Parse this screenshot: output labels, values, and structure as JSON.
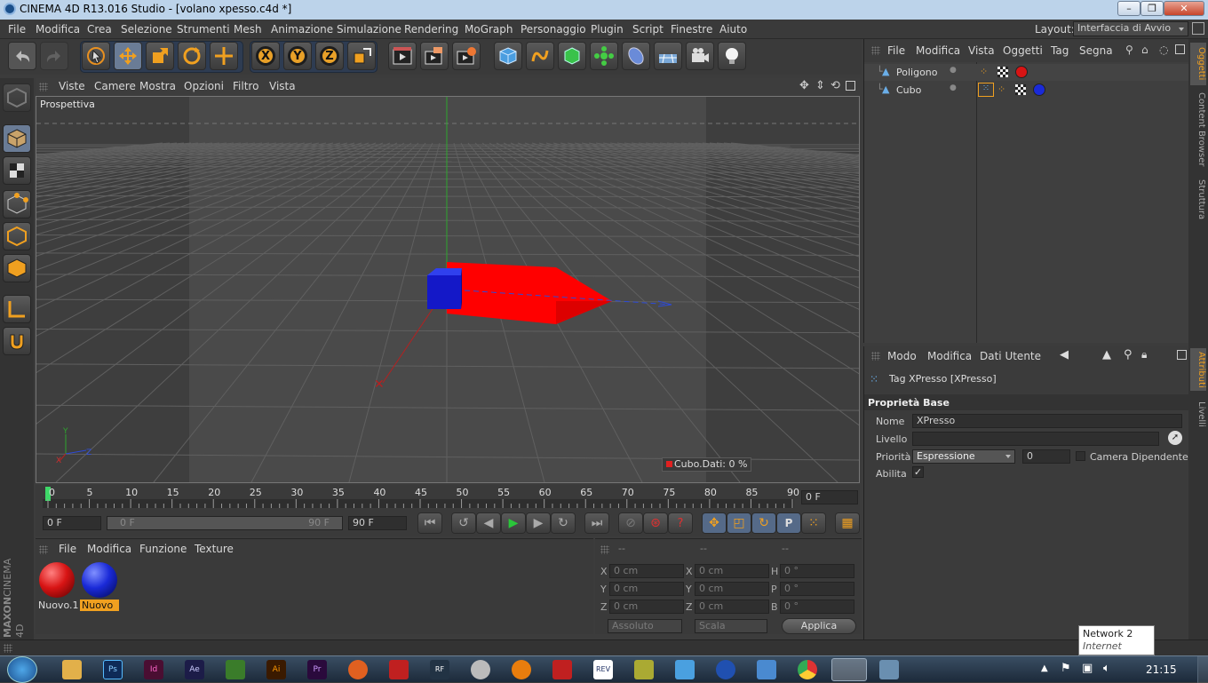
{
  "window": {
    "title": "CINEMA 4D R13.016 Studio - [volano xpesso.c4d *]",
    "layout_label": "Layout:",
    "layout_value": "Interfaccia di Avvio"
  },
  "menu": [
    "File",
    "Modifica",
    "Crea",
    "Selezione",
    "Strumenti",
    "Mesh",
    "Animazione",
    "Simulazione",
    "Rendering",
    "MoGraph",
    "Personaggio",
    "Plugin",
    "Script",
    "Finestre",
    "Aiuto"
  ],
  "toolbar": {
    "x_label": "X",
    "y_label": "Y",
    "z_label": "Z"
  },
  "viewport": {
    "menu": [
      "Viste",
      "Camere",
      "Mostra",
      "Opzioni",
      "Filtro",
      "Vista"
    ],
    "label": "Prospettiva",
    "hud": "Cubo.Dati:  0 %",
    "axis_y": "Y",
    "axis_x": "X",
    "axis_z": "Z"
  },
  "timeline": {
    "ticks": [
      "0",
      "5",
      "10",
      "15",
      "20",
      "25",
      "30",
      "35",
      "40",
      "45",
      "50",
      "55",
      "60",
      "65",
      "70",
      "75",
      "80",
      "85",
      "90"
    ],
    "current_frame": "0 F"
  },
  "transport": {
    "start": "0 F",
    "range_start": "0 F",
    "range_end": "90 F",
    "end": "90 F"
  },
  "materials": {
    "menu": [
      "File",
      "Modifica",
      "Funzione",
      "Texture"
    ],
    "items": [
      {
        "name": "Nuovo.1",
        "color": "#d81414"
      },
      {
        "name": "Nuovo",
        "color": "#1a2ad8"
      }
    ]
  },
  "coords": {
    "headers": [
      "--",
      "--",
      "--"
    ],
    "rows": [
      {
        "a": "X",
        "av": "0 cm",
        "b": "X",
        "bv": "0 cm",
        "c": "H",
        "cv": "0 °"
      },
      {
        "a": "Y",
        "av": "0 cm",
        "b": "Y",
        "bv": "0 cm",
        "c": "P",
        "cv": "0 °"
      },
      {
        "a": "Z",
        "av": "0 cm",
        "b": "Z",
        "bv": "0 cm",
        "c": "B",
        "cv": "0 °"
      }
    ],
    "mode1": "Assoluto",
    "mode2": "Scala",
    "apply": "Applica"
  },
  "objects": {
    "menu": [
      "File",
      "Modifica",
      "Vista",
      "Oggetti",
      "Tag",
      "Segna"
    ],
    "items": [
      {
        "name": "Poligono",
        "material_color": "#d81414"
      },
      {
        "name": "Cubo",
        "material_color": "#1a2ad8"
      }
    ]
  },
  "attributes": {
    "menu": [
      "Modo",
      "Modifica",
      "Dati Utente"
    ],
    "tag_title": "Tag XPresso [XPresso]",
    "section": "Proprietà Base",
    "name_label": "Nome",
    "name_value": "XPresso",
    "level_label": "Livello",
    "level_value": "",
    "priority_label": "Priorità",
    "priority_value": "Espressione",
    "priority_num": "0",
    "camera_dep": "Camera Dipendente",
    "enable_label": "Abilita",
    "enable_check": "✓"
  },
  "sidetabs": [
    "Oggetti",
    "Content Browser",
    "Struttura",
    "Attributi",
    "Livelli"
  ],
  "brand": {
    "line1": "MAXON",
    "line2": "CINEMA 4D"
  },
  "taskbar": {
    "tooltip_title": "Network  2",
    "tooltip_sub": "Internet access",
    "clock": "21:15"
  }
}
